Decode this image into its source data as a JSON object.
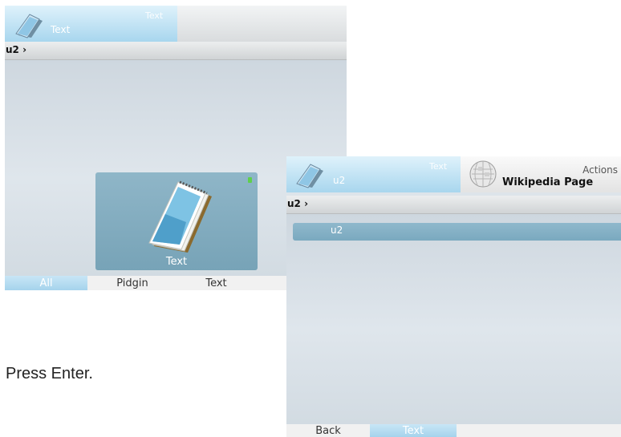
{
  "left_window": {
    "header": {
      "ghost_label": "Text",
      "active_label": "Text",
      "icon": "notepad-icon"
    },
    "breadcrumb": "u2 ›",
    "tile": {
      "label": "Text",
      "icon": "notepad-icon",
      "status_color": "#5fd04b"
    },
    "bottom_tabs": [
      "All",
      "Pidgin",
      "Text"
    ]
  },
  "right_window": {
    "header": {
      "ghost_label": "Text",
      "active_label": "u2",
      "icon": "notepad-icon"
    },
    "actions": {
      "title": "Actions",
      "item_label": "Wikipedia Page",
      "icon": "wikipedia-globe-icon"
    },
    "breadcrumb": "u2 ›",
    "list_items": [
      "u2"
    ],
    "bottom_tabs": [
      "Back",
      "Text"
    ]
  },
  "instruction": "Press Enter.",
  "colors": {
    "accent": "#a8d6ee",
    "selection": "#7aa9bf",
    "panel_bg": "#dde4ea"
  }
}
